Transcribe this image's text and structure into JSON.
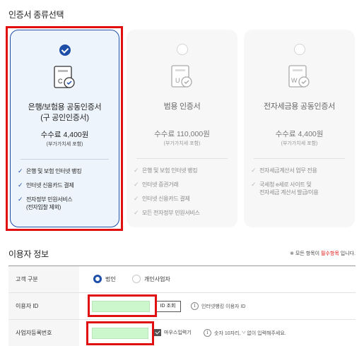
{
  "section_cert_type": "인증서 종류선택",
  "cards": [
    {
      "name_line1": "은행/보험용 공동인증서",
      "name_line2": "(구 공인인증서)",
      "fee": "수수료 4,400원",
      "vat": "(부가가치세 포함)",
      "icon_letter": "C",
      "features": [
        "은행 및 보험 인터넷 뱅킹",
        "인터넷 신용카드 결제",
        "전자정부 민원서비스",
        "(전자입찰 제외)"
      ],
      "selected": true
    },
    {
      "name_line1": "범용 인증서",
      "fee": "수수료 110,000원",
      "vat": "(부가가치세 포함)",
      "icon_letter": "U",
      "features": [
        "은행 및 보험 인터넷 뱅킹",
        "인터넷 증권거래",
        "인터넷 신용카드 결제",
        "모든 전자정부 민원서비스"
      ],
      "selected": false
    },
    {
      "name_line1": "전자세금용 공동인증서",
      "fee": "수수료 4,400원",
      "vat": "(부가가치세 포함)",
      "icon_letter": "W",
      "features": [
        "전자세금계산서 업무 전용",
        "국세청 e세로 사이트 및",
        "전자세금 계산서 발급/이용"
      ],
      "selected": false
    }
  ],
  "section_user_info": "이용자 정보",
  "required_note": {
    "prefix": "※ 모든 항목이 ",
    "highlight": "필수항목",
    "suffix": " 입니다."
  },
  "form": {
    "customer_type_label": "고객 구분",
    "option_corporate": "법인",
    "option_individual": "개인사업자",
    "user_id_label": "이용자 ID",
    "id_check_button": "ID 조회",
    "user_id_hint": "인터넷뱅킹 이용자 ID",
    "biz_number_label": "사업자등록번호",
    "mask_label": "마우스입력기",
    "biz_number_hint": "숫자 10자리, '-' 없이 입력해주세요."
  },
  "colors": {
    "accent": "#1e4fa8",
    "highlight_red": "#e01010",
    "input_green": "#ccf7cc"
  }
}
